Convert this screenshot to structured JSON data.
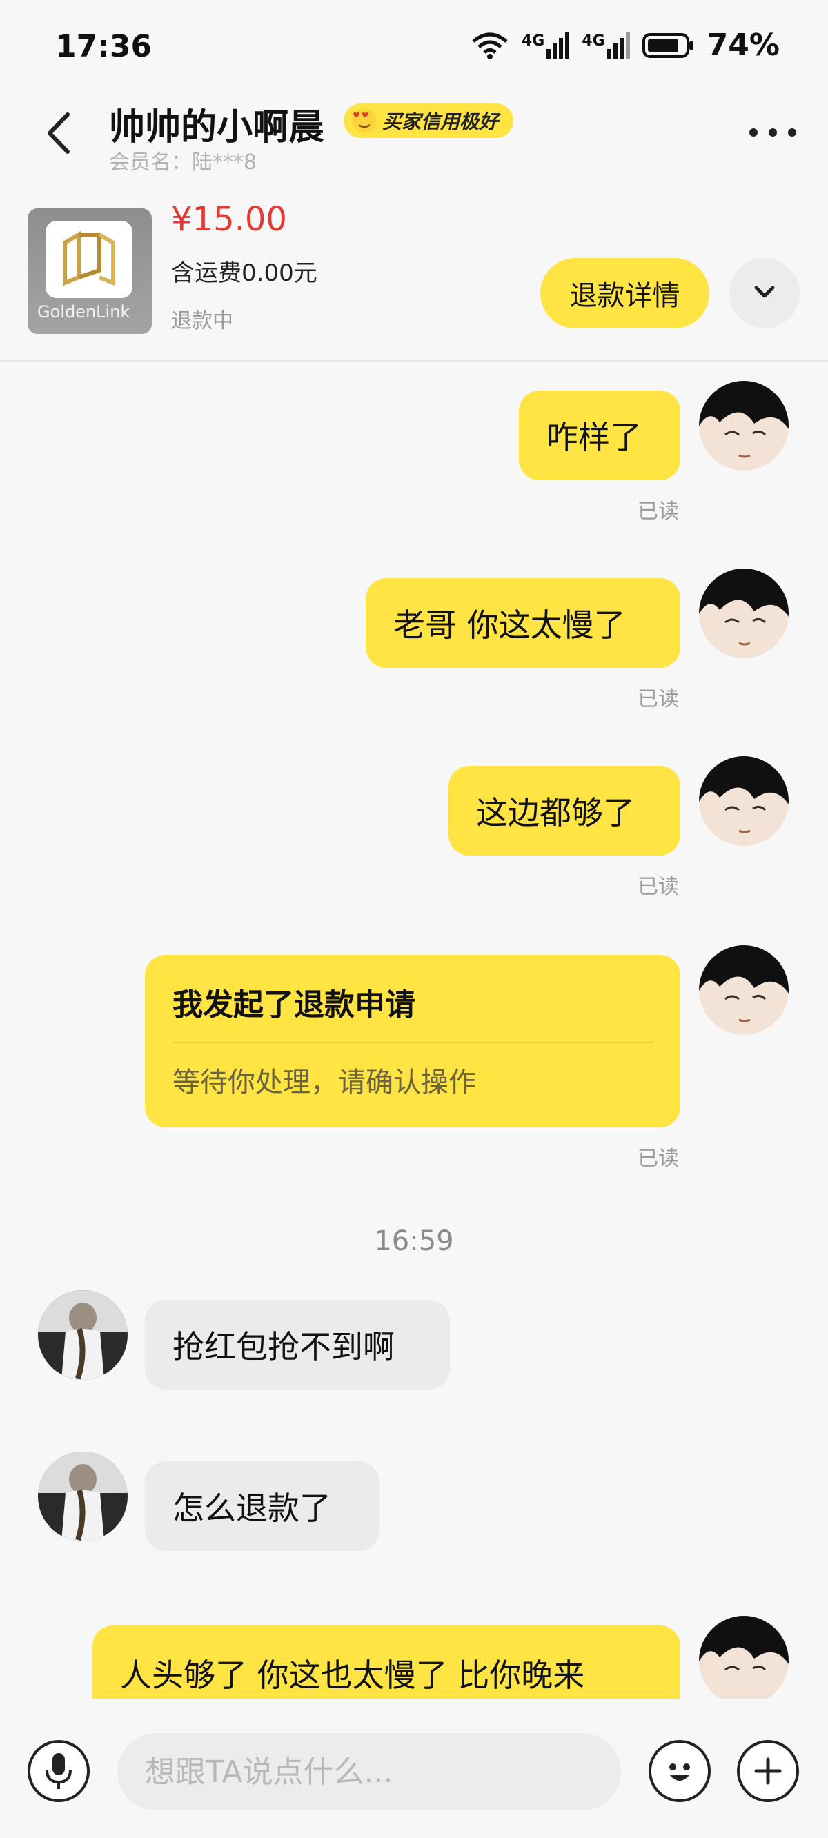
{
  "status_bar": {
    "time": "17:36",
    "network1": "4G",
    "network2": "4G",
    "battery": "74%"
  },
  "header": {
    "title": "帅帅的小啊晨",
    "credit_badge": "买家信用极好",
    "member_label": "会员名：陆***8"
  },
  "product": {
    "brand": "GoldenLink",
    "price": "¥15.00",
    "shipping": "含运费0.00元",
    "status": "退款中",
    "refund_button": "退款详情"
  },
  "messages": [
    {
      "sender": "me",
      "text": "咋样了",
      "read": "已读"
    },
    {
      "sender": "me",
      "text": "老哥 你这太慢了",
      "read": "已读"
    },
    {
      "sender": "me",
      "text": "这边都够了",
      "read": "已读"
    },
    {
      "sender": "me",
      "type": "refund_card",
      "title": "我发起了退款申请",
      "subtitle": "等待你处理，请确认操作",
      "read": "已读"
    },
    {
      "time_separator": "16:59"
    },
    {
      "sender": "other",
      "text": "抢红包抢不到啊"
    },
    {
      "sender": "other",
      "text": "怎么退款了"
    },
    {
      "sender": "me",
      "text": "人头够了 你这也太慢了 比你晚来"
    }
  ],
  "input": {
    "placeholder": "想跟TA说点什么..."
  },
  "colors": {
    "accent": "#ffe443",
    "price": "#e53935",
    "bubble_other": "#ebebeb"
  }
}
